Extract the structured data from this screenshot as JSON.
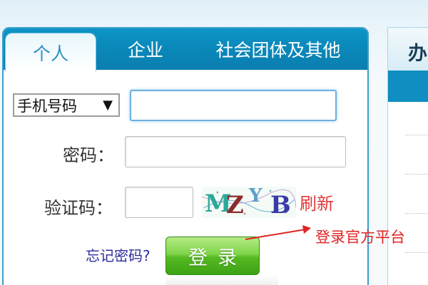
{
  "tabs": [
    {
      "label": "个人",
      "active": true
    },
    {
      "label": "企业",
      "active": false
    },
    {
      "label": "社会团体及其他",
      "active": false
    }
  ],
  "form": {
    "account_type": {
      "selected": "手机号码",
      "arrow": "▼"
    },
    "account_value": "",
    "password_label": "密码：",
    "password_value": "",
    "captcha_label": "验证码：",
    "captcha_value": "",
    "captcha_chars": [
      "M",
      "Z",
      "Y",
      "B"
    ],
    "refresh_label": "刷新",
    "forgot_label": "忘记密码?",
    "login_label": "登录"
  },
  "side_panel": {
    "title": "办"
  },
  "annotation": {
    "text": "登录官方平台"
  },
  "colors": {
    "tab_bar": "#0a86b8",
    "active_tab_text": "#2b8fc0",
    "login_button": "#55b923",
    "refresh_link": "#e23a3a",
    "forgot_link": "#2b2b9f",
    "annotation": "#e02424"
  }
}
